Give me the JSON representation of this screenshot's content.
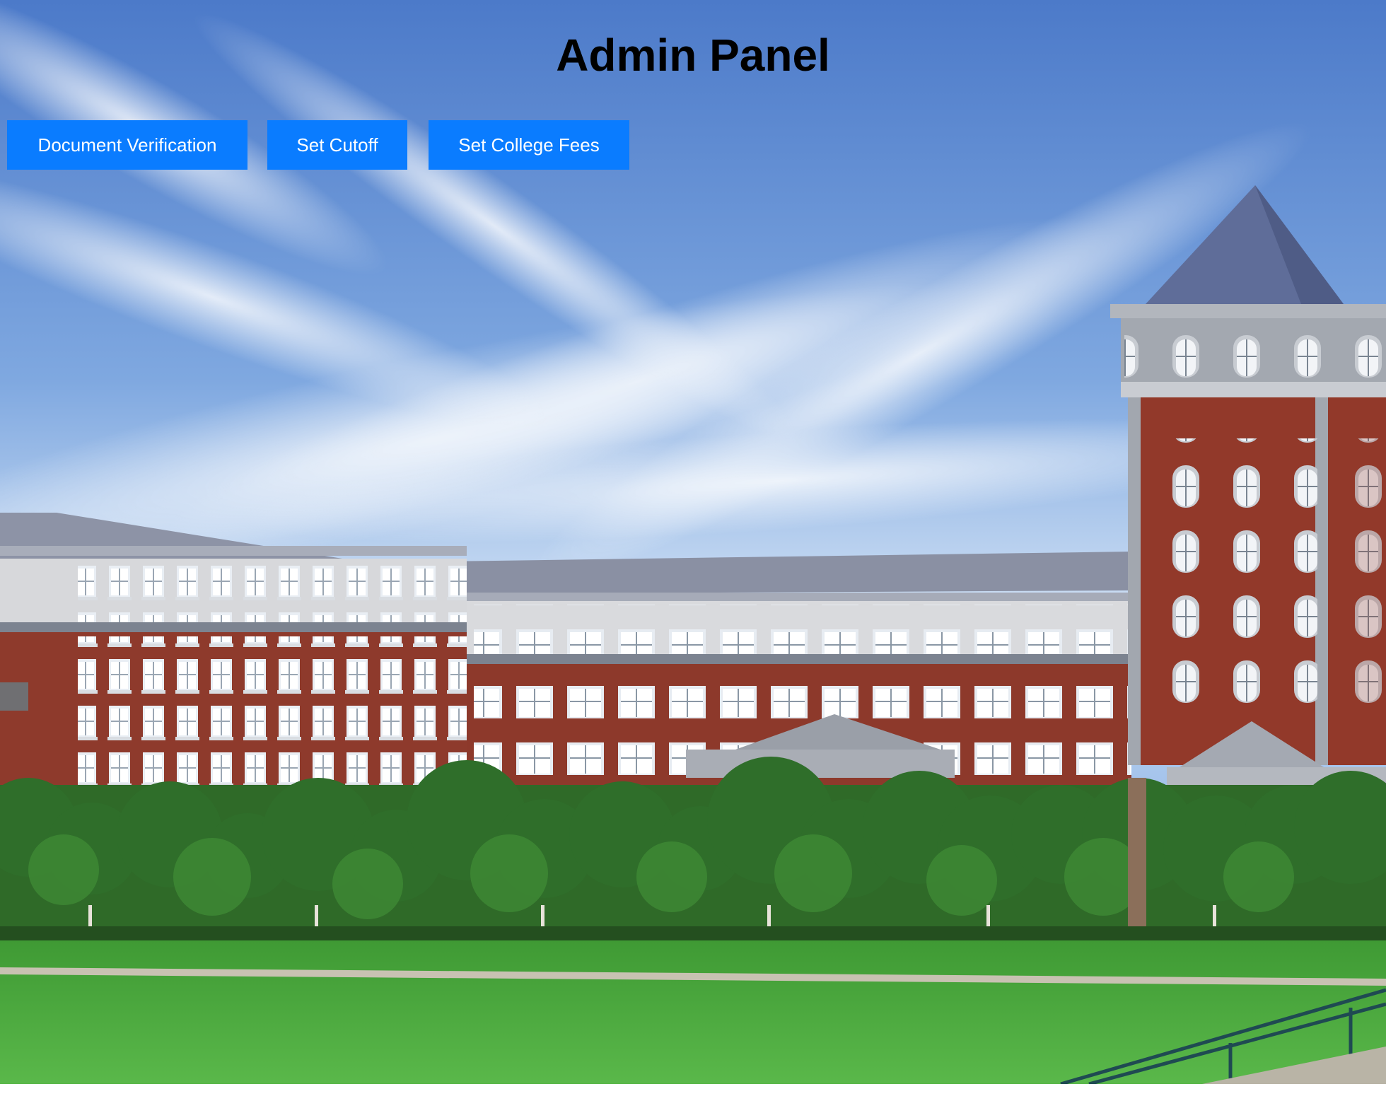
{
  "page": {
    "title": "Admin Panel"
  },
  "nav": {
    "buttons": [
      {
        "label": "Document Verification"
      },
      {
        "label": "Set Cutoff"
      },
      {
        "label": "Set College Fees"
      }
    ]
  },
  "colors": {
    "button_bg": "#0a7cff",
    "button_text": "#ffffff",
    "title_text": "#000000",
    "sky_top": "#4a78c8",
    "brick": "#8e3a2c",
    "lawn": "#4aa23a"
  },
  "background": {
    "description_icon": "college-campus-photo"
  }
}
